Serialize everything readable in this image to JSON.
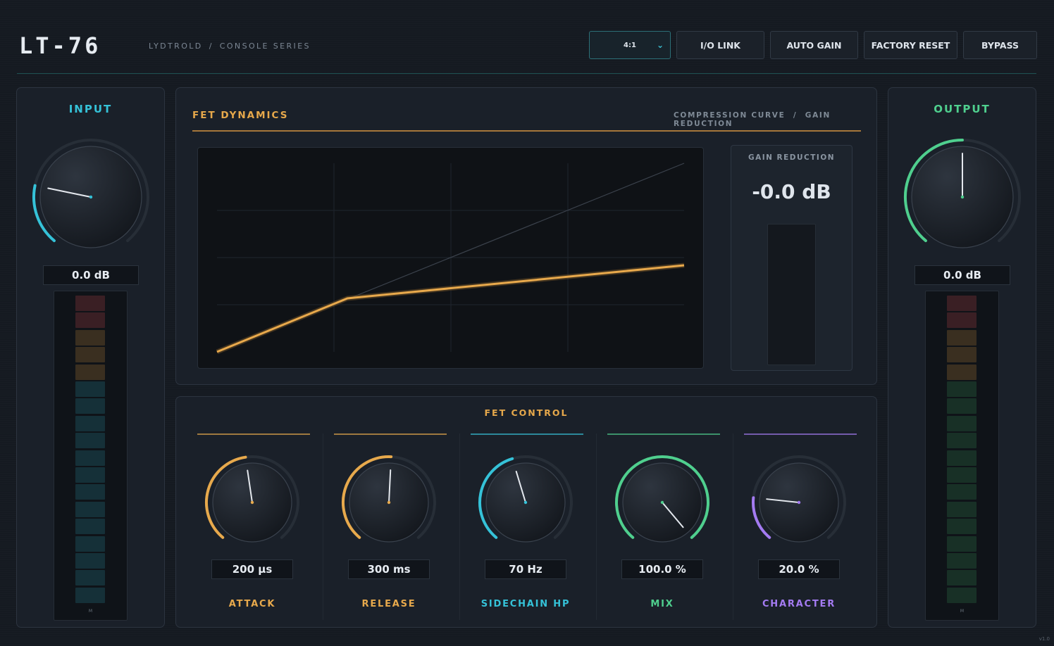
{
  "app": {
    "title": "LT-76",
    "brand": "LYDTROLD",
    "series": "CONSOLE SERIES",
    "version": "v1.0"
  },
  "toolbar": {
    "ratio": {
      "selected": "4:1",
      "options": [
        "4:1"
      ]
    },
    "io_link": "I/O LINK",
    "auto_gain": "AUTO GAIN",
    "factory_reset": "FACTORY RESET",
    "bypass": "BYPASS"
  },
  "input": {
    "title": "INPUT",
    "value": "0.0 dB",
    "level": 0.22,
    "accent": "#35c2d8",
    "meter_label": "M"
  },
  "output": {
    "title": "OUTPUT",
    "value": "0.0 dB",
    "level": 0.5,
    "accent": "#4fcf8e",
    "meter_label": "M"
  },
  "dynamics": {
    "title": "FET DYNAMICS",
    "subtitle_left": "COMPRESSION CURVE",
    "subtitle_sep": "/",
    "subtitle_right": "GAIN REDUCTION",
    "gain_reduction": {
      "label": "GAIN REDUCTION",
      "value": "-0.0 dB",
      "level": 0
    }
  },
  "control": {
    "title": "FET CONTROL",
    "knobs": [
      {
        "name": "ATTACK",
        "value": "200 µs",
        "level": 0.47,
        "color": "#e7a94c"
      },
      {
        "name": "RELEASE",
        "value": "300 ms",
        "level": 0.51,
        "color": "#e7a94c"
      },
      {
        "name": "SIDECHAIN HP",
        "value": "70 Hz",
        "level": 0.44,
        "color": "#35c2d8"
      },
      {
        "name": "MIX",
        "value": "100.0 %",
        "level": 1.0,
        "color": "#4fcf8e"
      },
      {
        "name": "CHARACTER",
        "value": "20.0 %",
        "level": 0.2,
        "color": "#a47bf2"
      }
    ]
  },
  "colors": {
    "background": "#151a21",
    "panel": "#1a2029",
    "accent_gold": "#e6a84b",
    "accent_cyan": "#35c2d8",
    "accent_green": "#4fcf8e",
    "accent_purple": "#a47bf2"
  }
}
